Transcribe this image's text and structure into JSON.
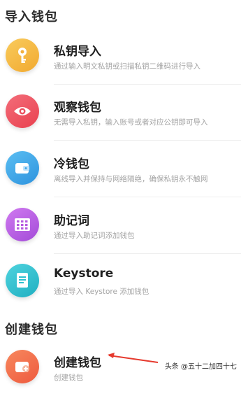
{
  "sections": {
    "import_title": "导入钱包",
    "create_title": "创建钱包"
  },
  "items": [
    {
      "title": "私钥导入",
      "desc": "通过输入明文私钥或扫描私钥二维码进行导入",
      "icon": "key-icon",
      "color": "#F4B63F"
    },
    {
      "title": "观察钱包",
      "desc": "无需导入私钥，输入账号或者对应公钥即可导入",
      "icon": "eye-icon",
      "color": "#EE5263"
    },
    {
      "title": "冷钱包",
      "desc": "离线导入并保持与网络隔绝，确保私钥永不触网",
      "icon": "wallet-icon",
      "color": "#3DA6E8"
    },
    {
      "title": "助记词",
      "desc": "通过导入助记词添加钱包",
      "icon": "grid-icon",
      "color": "#B65BE0"
    },
    {
      "title": "Keystore",
      "desc": "通过导入 Keystore 添加钱包",
      "icon": "document-icon",
      "color": "#2CC1CF"
    }
  ],
  "create_item": {
    "title": "创建钱包",
    "desc": "创建钱包",
    "icon": "wallet-plus-icon",
    "color": "#F0684A"
  },
  "watermark": "头条 @五十二加四十七"
}
